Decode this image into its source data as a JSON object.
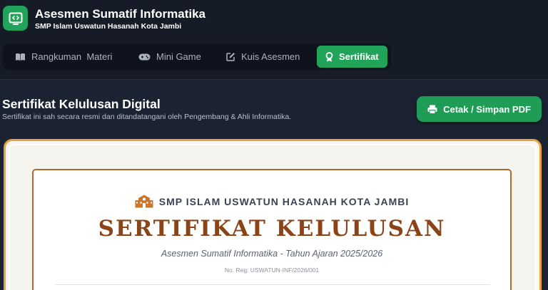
{
  "app": {
    "title": "Asesmen Sumatif Informatika",
    "subtitle": "SMP Islam Uswatun Hasanah Kota Jambi"
  },
  "nav": {
    "tabs": [
      {
        "label": "Rangkuman  Materi",
        "icon": "book-icon"
      },
      {
        "label": "Mini Game",
        "icon": "gamepad-icon"
      },
      {
        "label": "Kuis Asesmen",
        "icon": "edit-icon"
      },
      {
        "label": "Sertifikat",
        "icon": "award-icon",
        "active": true
      }
    ]
  },
  "section": {
    "title": "Sertifikat Kelulusan Digital",
    "description": "Sertifikat ini sah secara resmi dan ditandatangani oleh Pengembang & Ahli Informatika."
  },
  "actions": {
    "print_label": "Cetak / Simpan PDF"
  },
  "certificate": {
    "school": "SMP ISLAM USWATUN HASANAH KOTA JAMBI",
    "title": "SERTIFIKAT KELULUSAN",
    "subtitle": "Asesmen Sumatif Informatika - Tahun Ajaran 2025/2026",
    "reg_no": "No. Reg: USWATUN-INF/2026/001"
  },
  "colors": {
    "accent": "#22a35a",
    "frame": "#e6a23c",
    "title": "#8a4418"
  }
}
